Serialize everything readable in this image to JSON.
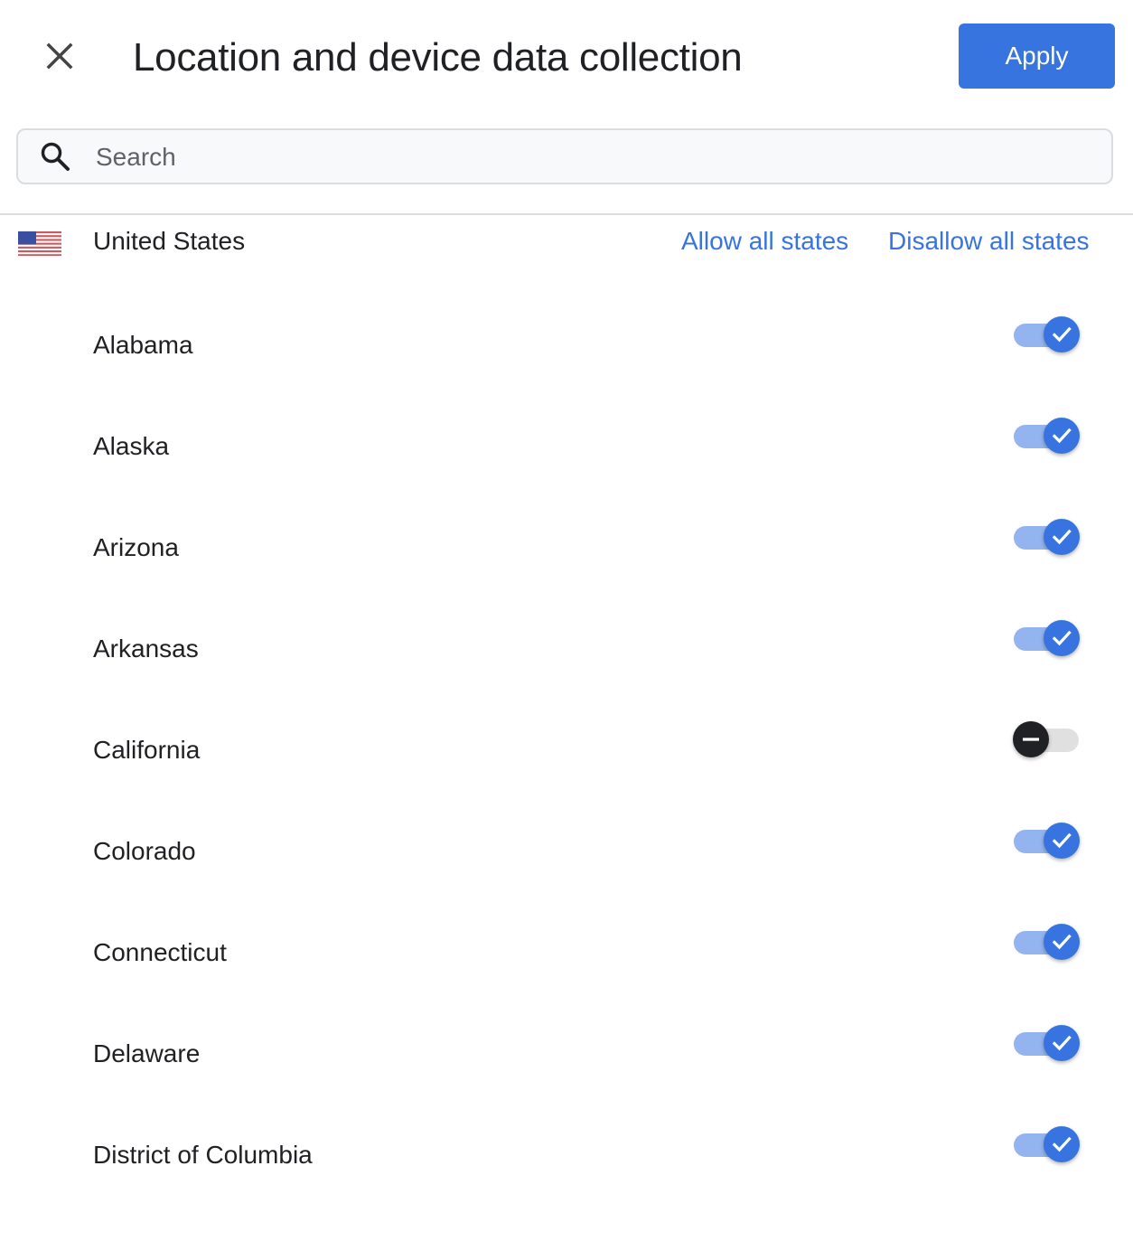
{
  "header": {
    "title": "Location and device data collection",
    "apply_label": "Apply",
    "close_icon": "close-icon"
  },
  "search": {
    "placeholder": "Search",
    "value": "",
    "icon": "search-icon"
  },
  "country": {
    "name": "United States",
    "flag_icon": "us-flag-icon",
    "allow_all_label": "Allow all states",
    "disallow_all_label": "Disallow all states"
  },
  "colors": {
    "accent": "#3774e0",
    "toggle_on_track": "#94b4ef",
    "toggle_off_track": "#e0e0e0",
    "toggle_off_knob": "#202124"
  },
  "states": [
    {
      "name": "Alabama",
      "allowed": true
    },
    {
      "name": "Alaska",
      "allowed": true
    },
    {
      "name": "Arizona",
      "allowed": true
    },
    {
      "name": "Arkansas",
      "allowed": true
    },
    {
      "name": "California",
      "allowed": false
    },
    {
      "name": "Colorado",
      "allowed": true
    },
    {
      "name": "Connecticut",
      "allowed": true
    },
    {
      "name": "Delaware",
      "allowed": true
    },
    {
      "name": "District of Columbia",
      "allowed": true
    }
  ]
}
